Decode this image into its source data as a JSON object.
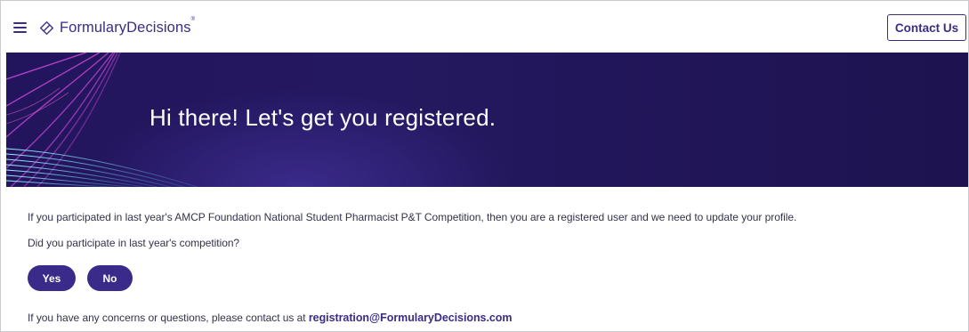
{
  "header": {
    "brand": "FormularyDecisions",
    "brand_mark": "®",
    "contact_label": "Contact Us",
    "icons": {
      "menu": "hamburger-menu-icon",
      "logo": "formulary-decisions-logo-icon"
    }
  },
  "hero": {
    "title": "Hi there! Let's get you registered."
  },
  "content": {
    "intro": "If you participated in last year's AMCP Foundation National Student Pharmacist P&T Competition, then you are a registered user and we need to update your profile.",
    "question": "Did you participate in last year's competition?",
    "yes_label": "Yes",
    "no_label": "No",
    "contact_prefix": "If you have any concerns or questions, please contact us at ",
    "contact_email": "registration@FormularyDecisions.com"
  },
  "colors": {
    "brand": "#3b2d86",
    "hero_bg": "#23155d",
    "pill_bg": "#3a2a8a",
    "accent_pink": "#e040c0",
    "accent_cyan": "#7ee3f5"
  }
}
